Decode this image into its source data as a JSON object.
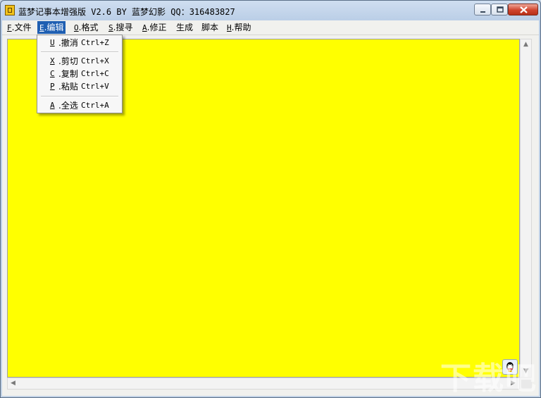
{
  "window": {
    "title": "蓝梦记事本增强版 V2.6 BY 蓝梦幻影 QQ：316483827"
  },
  "menu": [
    {
      "acc": "F",
      "label": ".文件"
    },
    {
      "acc": "E",
      "label": ".编辑"
    },
    {
      "acc": "O",
      "label": ".格式"
    },
    {
      "acc": "S",
      "label": ".搜寻"
    },
    {
      "acc": "A",
      "label": ".修正"
    },
    {
      "acc": "",
      "label": "生成"
    },
    {
      "acc": "",
      "label": "脚本"
    },
    {
      "acc": "H",
      "label": ".帮助"
    }
  ],
  "edit_menu": [
    {
      "acc": "U",
      "label": ".撤消",
      "shortcut": "Ctrl+Z"
    },
    {
      "acc": "X",
      "label": ".剪切",
      "shortcut": "Ctrl+X"
    },
    {
      "acc": "C",
      "label": ".复制",
      "shortcut": "Ctrl+C"
    },
    {
      "acc": "P",
      "label": ".粘贴",
      "shortcut": "Ctrl+V"
    },
    {
      "acc": "A",
      "label": ".全选",
      "shortcut": "Ctrl+A"
    }
  ],
  "colors": {
    "editor_background": "#ffff00",
    "menu_highlight": "#1f5fb2"
  },
  "icons": {
    "app": "app-icon",
    "tray": "qq-penguin-icon"
  },
  "watermark": "下载吧"
}
